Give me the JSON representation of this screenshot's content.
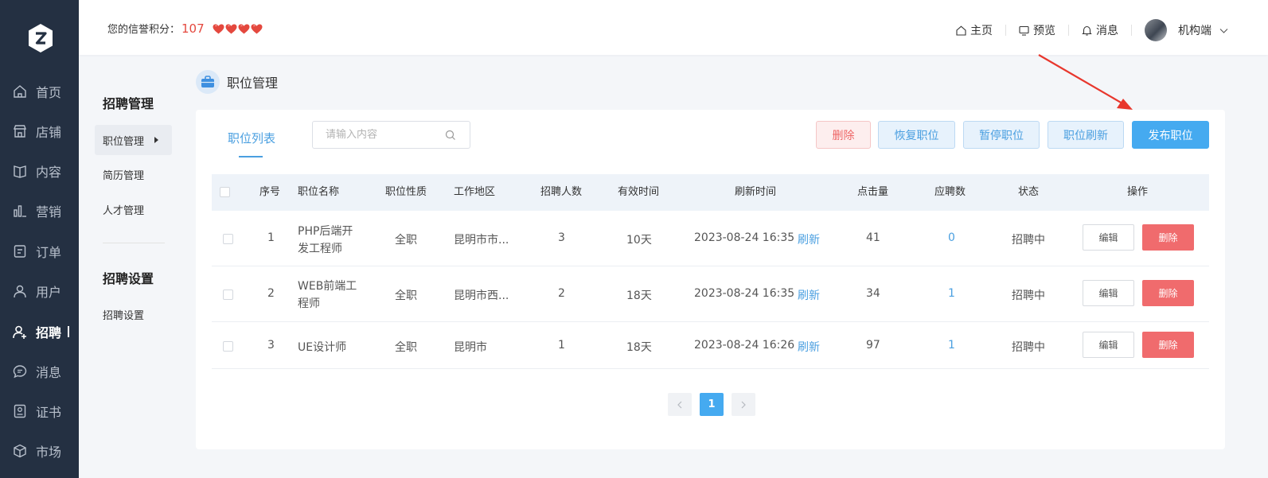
{
  "colors": {
    "sidebar_bg": "#243042",
    "accent": "#45aaf0",
    "danger": "#f06b6d",
    "heart": "#e4483e"
  },
  "header": {
    "credit_label": "您的信誉积分：",
    "credit_score": "107",
    "hearts": 4,
    "links": [
      {
        "label": "主页",
        "icon": "home-icon"
      },
      {
        "label": "预览",
        "icon": "monitor-icon"
      },
      {
        "label": "消息",
        "icon": "bell-icon"
      }
    ],
    "account": {
      "label": "机构端",
      "icon": "chevron-down-icon"
    }
  },
  "sidebar": {
    "items": [
      {
        "label": "首页",
        "icon": "home-icon"
      },
      {
        "label": "店铺",
        "icon": "store-icon"
      },
      {
        "label": "内容",
        "icon": "book-icon"
      },
      {
        "label": "营销",
        "icon": "bar-chart-icon"
      },
      {
        "label": "订单",
        "icon": "order-icon"
      },
      {
        "label": "用户",
        "icon": "user-icon"
      },
      {
        "label": "招聘",
        "icon": "user-add-icon",
        "active": true
      },
      {
        "label": "消息",
        "icon": "chat-icon"
      },
      {
        "label": "证书",
        "icon": "certificate-icon"
      },
      {
        "label": "市场",
        "icon": "cube-icon"
      }
    ]
  },
  "subnav": {
    "section1": "招聘管理",
    "items1": [
      "职位管理",
      "简历管理",
      "人才管理"
    ],
    "section2": "招聘设置",
    "items2": [
      "招聘设置"
    ]
  },
  "page": {
    "title": "职位管理"
  },
  "toolbar": {
    "tab": "职位列表",
    "search_placeholder": "请输入内容",
    "delete": "删除",
    "restore": "恢复职位",
    "pause": "暂停职位",
    "refresh": "职位刷新",
    "publish": "发布职位"
  },
  "table": {
    "columns": [
      "序号",
      "职位名称",
      "职位性质",
      "工作地区",
      "招聘人数",
      "有效时间",
      "刷新时间",
      "点击量",
      "应聘数",
      "状态",
      "操作"
    ],
    "rows": [
      {
        "no": "1",
        "name1": "PHP后端开",
        "name2": "发工程师",
        "type": "全职",
        "area": "昆明市市...",
        "count": "3",
        "valid": "10天",
        "refresh_time": "2023-08-24 16:35",
        "refresh_link": "刷新",
        "clicks": "41",
        "applies": "0",
        "status": "招聘中",
        "edit": "编辑",
        "del": "删除"
      },
      {
        "no": "2",
        "name1": "WEB前端工",
        "name2": "程师",
        "type": "全职",
        "area": "昆明市西...",
        "count": "2",
        "valid": "18天",
        "refresh_time": "2023-08-24 16:35",
        "refresh_link": "刷新",
        "clicks": "34",
        "applies": "1",
        "status": "招聘中",
        "edit": "编辑",
        "del": "删除"
      },
      {
        "no": "3",
        "name1": "UE设计师",
        "name2": "",
        "type": "全职",
        "area": "昆明市",
        "count": "1",
        "valid": "18天",
        "refresh_time": "2023-08-24 16:26",
        "refresh_link": "刷新",
        "clicks": "97",
        "applies": "1",
        "status": "招聘中",
        "edit": "编辑",
        "del": "删除"
      }
    ]
  },
  "pagination": {
    "current": "1"
  }
}
